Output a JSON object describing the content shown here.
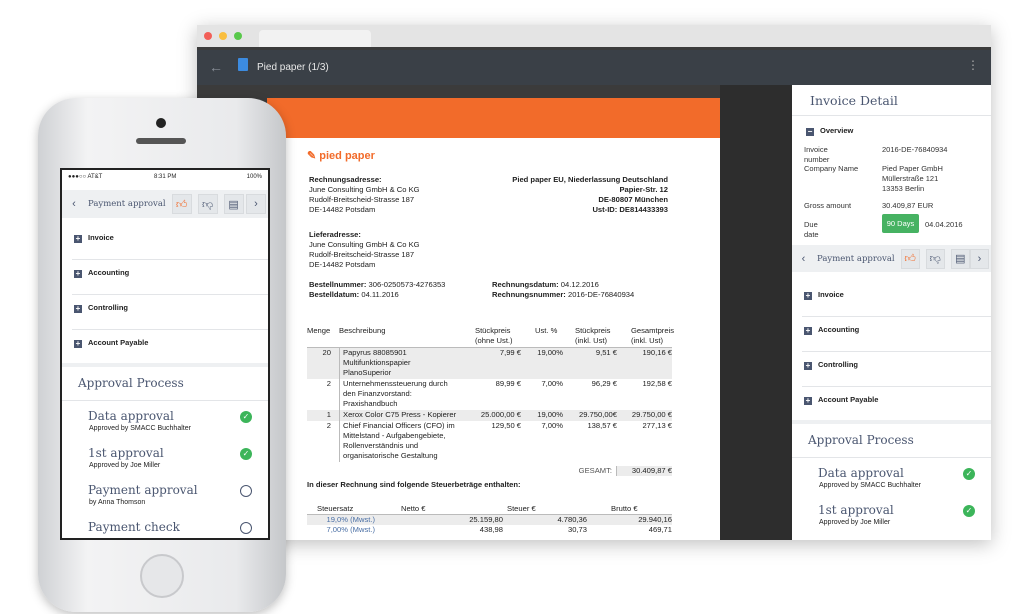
{
  "browser": {
    "title": "Pied paper (1/3)",
    "colors": {
      "toolbar": "#3a4047",
      "accent": "#f26b2a"
    }
  },
  "invoice": {
    "logo": "pied paper",
    "billing": {
      "heading": "Rechnungsadresse:",
      "lines": [
        "June Consulting GmbH & Co KG",
        "Rudolf-Breitscheid-Strasse 187",
        "DE-14482 Potsdam"
      ]
    },
    "seller": {
      "lines": [
        "Pied paper EU, Niederlassung Deutschland",
        "Papier-Str. 12",
        "DE-80807 München",
        "Ust-ID: DE814433393"
      ]
    },
    "delivery": {
      "heading": "Lieferadresse:",
      "lines": [
        "June Consulting GmbH & Co KG",
        "Rudolf-Breitscheid-Strasse 187",
        "DE-14482 Potsdam"
      ]
    },
    "order_no_label": "Bestellnummer:",
    "order_no": "306-0250573-4276353",
    "order_date_label": "Bestelldatum:",
    "order_date": "04.11.2016",
    "inv_date_label": "Rechnungsdatum:",
    "inv_date": "04.12.2016",
    "inv_no_label": "Rechnungsnummer:",
    "inv_no": "2016-DE-76840934",
    "columns": [
      "Menge",
      "Beschreibung",
      "Stückpreis\n(ohne Ust.)",
      "Ust. %",
      "Stückpreis\n(inkl. Ust)",
      "Gesamtpreis\n(inkl. Ust)"
    ],
    "rows": [
      [
        "20",
        "Papyrus 88085901\nMultifunktionspapier\nPlanoSuperior",
        "7,99 €",
        "19,00%",
        "9,51 €",
        "190,16 €"
      ],
      [
        "2",
        "Unternehmenssteuerung durch\nden Finanzvorstand:\nPraxishandbuch",
        "89,99 €",
        "7,00%",
        "96,29 €",
        "192,58 €"
      ],
      [
        "1",
        "Xerox Color C75 Press - Kopierer",
        "25.000,00 €",
        "19,00%",
        "29.750,00€",
        "29.750,00 €"
      ],
      [
        "2",
        "Chief Financial Officers (CFO) im\nMittelstand - Aufgabengebiete,\nRollenverständnis und\norganisatorische Gestaltung",
        "129,50 €",
        "7,00%",
        "138,57 €",
        "277,13 €"
      ]
    ],
    "total_label": "GESAMT:",
    "total": "30.409,87 €",
    "tax_heading": "In dieser Rechnung sind folgende Steuerbeträge enthalten:",
    "tax_columns": [
      "Steuersatz",
      "Netto €",
      "Steuer €",
      "Brutto €"
    ],
    "tax_rows": [
      [
        "19,0% (Mwst.)",
        "25.159,80",
        "4.780,36",
        "29.940,16"
      ],
      [
        "7,00% (Mwst.)",
        "438,98",
        "30,73",
        "469,71"
      ]
    ]
  },
  "detail": {
    "title": "Invoice Detail",
    "overview": "Overview",
    "fields": [
      {
        "label": "Invoice number",
        "value": "2016-DE-76840934"
      },
      {
        "label": "Company Name",
        "value": "Pied Paper GmbH\nMüllerstraße 121\n13353 Berlin"
      },
      {
        "label": "Gross amount",
        "value": "30.409,87 EUR"
      }
    ],
    "due_label": "Due date",
    "due_badge": "90 Days",
    "due_date": "04.04.2016"
  },
  "approval_bar": {
    "label": "Payment approval"
  },
  "sections": [
    "Invoice",
    "Accounting",
    "Controlling",
    "Account Payable"
  ],
  "approval": {
    "title": "Approval Process",
    "steps": [
      {
        "name": "Data approval",
        "sub": "Approved by SMACC Buchhalter",
        "done": true
      },
      {
        "name": "1st approval",
        "sub": "Approved by Joe Miller",
        "done": true
      },
      {
        "name": "Payment approval",
        "sub": "by Anna Thomson",
        "done": false
      },
      {
        "name": "Payment check",
        "sub": "",
        "done": false
      }
    ]
  },
  "phone_status": {
    "carrier": "●●●○○ AT&T",
    "time": "8:31 PM",
    "battery": "100%"
  }
}
